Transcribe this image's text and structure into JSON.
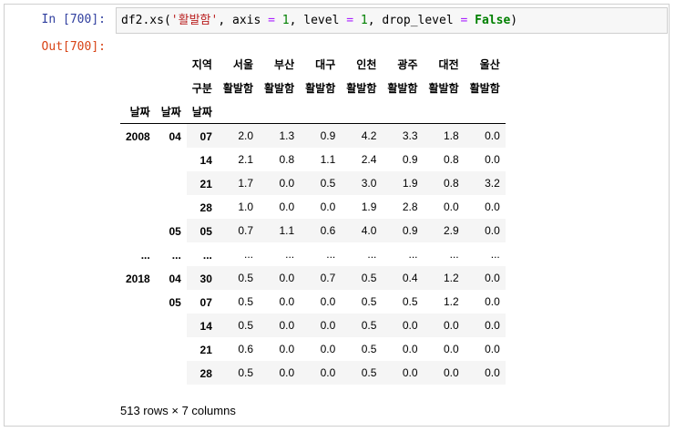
{
  "input_prompt": "In [700]:",
  "output_prompt": "Out[700]:",
  "code": {
    "prefix": "df2.xs(",
    "arg_str": "'활발함'",
    "sep1": ", axis ",
    "eq": "=",
    "sp": " ",
    "one_a": "1",
    "sep2": ", level ",
    "one_b": "1",
    "sep3": ", drop_level ",
    "false_kw": "False",
    "suffix": ")"
  },
  "table": {
    "col_level0_name": "지역",
    "col_level1_name": "구분",
    "columns": [
      "서울",
      "부산",
      "대구",
      "인천",
      "광주",
      "대전",
      "울산"
    ],
    "sub_columns": [
      "활발함",
      "활발함",
      "활발함",
      "활발함",
      "활발함",
      "활발함",
      "활발함"
    ],
    "index_names": [
      "날짜",
      "날짜",
      "날짜"
    ],
    "rows": [
      {
        "i0": "2008",
        "i1": "04",
        "i2": "07",
        "v": [
          "2.0",
          "1.3",
          "0.9",
          "4.2",
          "3.3",
          "1.8",
          "0.0"
        ]
      },
      {
        "i0": "",
        "i1": "",
        "i2": "14",
        "v": [
          "2.1",
          "0.8",
          "1.1",
          "2.4",
          "0.9",
          "0.8",
          "0.0"
        ]
      },
      {
        "i0": "",
        "i1": "",
        "i2": "21",
        "v": [
          "1.7",
          "0.0",
          "0.5",
          "3.0",
          "1.9",
          "0.8",
          "3.2"
        ]
      },
      {
        "i0": "",
        "i1": "",
        "i2": "28",
        "v": [
          "1.0",
          "0.0",
          "0.0",
          "1.9",
          "2.8",
          "0.0",
          "0.0"
        ]
      },
      {
        "i0": "",
        "i1": "05",
        "i2": "05",
        "v": [
          "0.7",
          "1.1",
          "0.6",
          "4.0",
          "0.9",
          "2.9",
          "0.0"
        ]
      },
      {
        "i0": "...",
        "i1": "...",
        "i2": "...",
        "v": [
          "...",
          "...",
          "...",
          "...",
          "...",
          "...",
          "..."
        ]
      },
      {
        "i0": "2018",
        "i1": "04",
        "i2": "30",
        "v": [
          "0.5",
          "0.0",
          "0.7",
          "0.5",
          "0.4",
          "1.2",
          "0.0"
        ]
      },
      {
        "i0": "",
        "i1": "05",
        "i2": "07",
        "v": [
          "0.5",
          "0.0",
          "0.0",
          "0.5",
          "0.5",
          "1.2",
          "0.0"
        ]
      },
      {
        "i0": "",
        "i1": "",
        "i2": "14",
        "v": [
          "0.5",
          "0.0",
          "0.0",
          "0.5",
          "0.0",
          "0.0",
          "0.0"
        ]
      },
      {
        "i0": "",
        "i1": "",
        "i2": "21",
        "v": [
          "0.6",
          "0.0",
          "0.0",
          "0.5",
          "0.0",
          "0.0",
          "0.0"
        ]
      },
      {
        "i0": "",
        "i1": "",
        "i2": "28",
        "v": [
          "0.5",
          "0.0",
          "0.0",
          "0.5",
          "0.0",
          "0.0",
          "0.0"
        ]
      }
    ]
  },
  "footer": "513 rows × 7 columns"
}
